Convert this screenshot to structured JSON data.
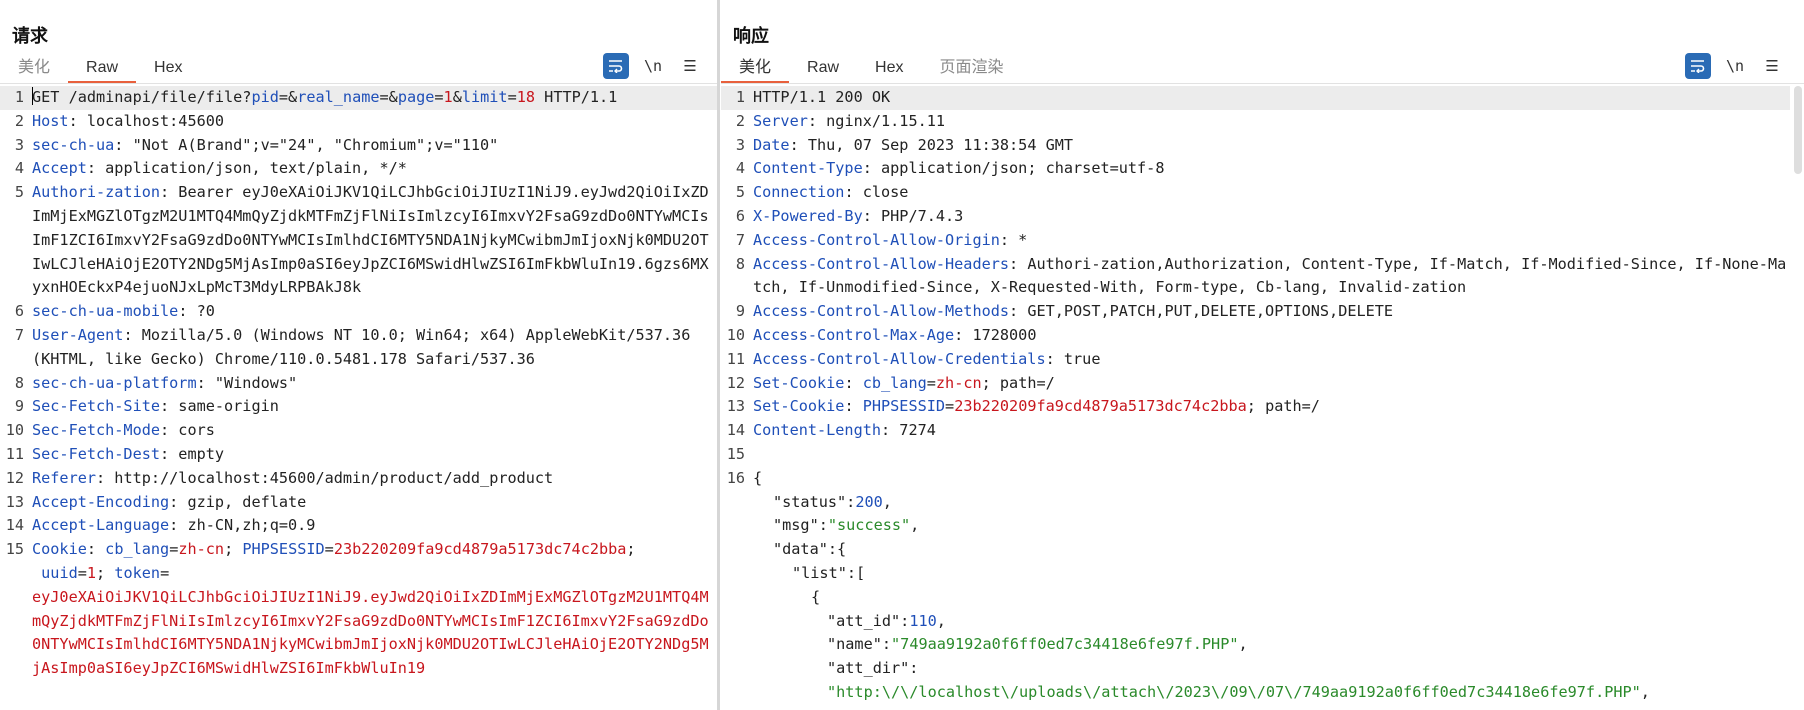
{
  "layout": {
    "btn_split": "split-view",
    "btn_rows": "stacked-view",
    "btn_single": "single-view"
  },
  "request": {
    "title": "请求",
    "tabs": [
      "美化",
      "Raw",
      "Hex"
    ],
    "active_tab": "Raw",
    "tool_wrap": "≡",
    "tool_newline": "\\n",
    "tool_menu": "☰",
    "lines": {
      "l1": {
        "method": "GET /adminapi/file/file?",
        "p1": "pid",
        "eq": "=",
        "amp": "&",
        "p2": "real_name",
        "p3": "page",
        "v3": "1",
        "p4": "limit",
        "v4": "18",
        "proto": " HTTP/1.1"
      },
      "l2": {
        "key": "Host",
        "val": ": localhost:45600"
      },
      "l3": {
        "key": "sec-ch-ua",
        "val": ": \"Not A(Brand\";v=\"24\", \"Chromium\";v=\"110\""
      },
      "l4": {
        "key": "Accept",
        "val": ": application/json, text/plain, */*"
      },
      "l5": {
        "key": "Authori-zation",
        "val": ": Bearer eyJ0eXAiOiJKV1QiLCJhbGciOiJIUzI1NiJ9.eyJwd2QiOiIxZDImMjExMGZlOTgzM2U1MTQ4MmQyZjdkMTFmZjFlNiIsImlzcyI6ImxvY2FsaG9zdDo0NTYwMCIsImF1ZCI6ImxvY2FsaG9zdDo0NTYwMCIsImlhdCI6MTY5NDA1NjkyMCwibmJmIjoxNjk0MDU2OTIwLCJleHAiOjE2OTY2NDg5MjAsImp0aSI6eyJpZCI6MSwidHlwZSI6ImFkbWluIn19.6gzs6MXyxnHOEckxP4ejuoNJxLpMcT3MdyLRPBAkJ8k"
      },
      "l6": {
        "key": "sec-ch-ua-mobile",
        "val": ": ?0"
      },
      "l7": {
        "key": "User-Agent",
        "val": ": Mozilla/5.0 (Windows NT 10.0; Win64; x64) AppleWebKit/537.36 (KHTML, like Gecko) Chrome/110.0.5481.178 Safari/537.36"
      },
      "l8": {
        "key": "sec-ch-ua-platform",
        "val": ": \"Windows\""
      },
      "l9": {
        "key": "Sec-Fetch-Site",
        "val": ": same-origin"
      },
      "l10": {
        "key": "Sec-Fetch-Mode",
        "val": ": cors"
      },
      "l11": {
        "key": "Sec-Fetch-Dest",
        "val": ": empty"
      },
      "l12": {
        "key": "Referer",
        "val": ": http://localhost:45600/admin/product/add_product"
      },
      "l13": {
        "key": "Accept-Encoding",
        "val": ": gzip, deflate"
      },
      "l14": {
        "key": "Accept-Language",
        "val": ": zh-CN,zh;q=0.9"
      },
      "l15": {
        "key": "Cookie",
        "sep": ": ",
        "c1k": "cb_lang",
        "eq": "=",
        "c1v": "zh-cn",
        "semi": "; ",
        "c2k": "PHPSESSID",
        "c2v": "23b220209fa9cd4879a5173dc74c2bba",
        "semi2": ";",
        "c3k": " uuid",
        "c3v": "1",
        "semi3": "; ",
        "c4k": "token",
        "eq2": "=",
        "c4v": "eyJ0eXAiOiJKV1QiLCJhbGciOiJIUzI1NiJ9.eyJwd2QiOiIxZDImMjExMGZlOTgzM2U1MTQ4MmQyZjdkMTFmZjFlNiIsImlzcyI6ImxvY2FsaG9zdDo0NTYwMCIsImF1ZCI6ImxvY2FsaG9zdDo0NTYwMCIsImlhdCI6MTY5NDA1NjkyMCwibmJmIjoxNjk0MDU2OTIwLCJleHAiOjE2OTY2NDg5MjAsImp0aSI6eyJpZCI6MSwidHlwZSI6ImFkbWluIn19"
      }
    }
  },
  "response": {
    "title": "响应",
    "tabs": [
      "美化",
      "Raw",
      "Hex",
      "页面渲染"
    ],
    "active_tab": "美化",
    "tool_wrap": "≡",
    "tool_newline": "\\n",
    "tool_menu": "☰",
    "lines": {
      "l1": "HTTP/1.1 200 OK",
      "l2": {
        "key": "Server",
        "val": ": nginx/1.15.11"
      },
      "l3": {
        "key": "Date",
        "val": ": Thu, 07 Sep 2023 11:38:54 GMT"
      },
      "l4": {
        "key": "Content-Type",
        "val": ": application/json; charset=utf-8"
      },
      "l5": {
        "key": "Connection",
        "val": ": close"
      },
      "l6": {
        "key": "X-Powered-By",
        "val": ": PHP/7.4.3"
      },
      "l7": {
        "key": "Access-Control-Allow-Origin",
        "val": ": *"
      },
      "l8": {
        "key": "Access-Control-Allow-Headers",
        "val": ": Authori-zation,Authorization, Content-Type, If-Match, If-Modified-Since, If-None-Match, If-Unmodified-Since, X-Requested-With, Form-type, Cb-lang, Invalid-zation"
      },
      "l9": {
        "key": "Access-Control-Allow-Methods",
        "val": ": GET,POST,PATCH,PUT,DELETE,OPTIONS,DELETE"
      },
      "l10": {
        "key": "Access-Control-Max-Age",
        "val": ": 1728000"
      },
      "l11": {
        "key": "Access-Control-Allow-Credentials",
        "val": ": true"
      },
      "l12": {
        "key": "Set-Cookie",
        "sep": ": ",
        "ck": "cb_lang",
        "eq": "=",
        "cv": "zh-cn",
        "rest": "; path=/"
      },
      "l13": {
        "key": "Set-Cookie",
        "sep": ": ",
        "ck": "PHPSESSID",
        "eq": "=",
        "cv": "23b220209fa9cd4879a5173dc74c2bba",
        "rest": "; path=/"
      },
      "l14": {
        "key": "Content-Length",
        "val": ": 7274"
      },
      "l16": "{",
      "j_status_k": "\"status\"",
      "j_status_v": "200",
      "j_msg_k": "\"msg\"",
      "j_msg_v": "\"success\"",
      "j_data_k": "\"data\"",
      "j_data_open": ":{",
      "j_list_k": "\"list\"",
      "j_list_open": ":[",
      "j_obj_open": "{",
      "j_attid_k": "\"att_id\"",
      "j_attid_v": "110",
      "j_name_k": "\"name\"",
      "j_name_v": "\"749aa9192a0f6ff0ed7c34418e6fe97f.PHP\"",
      "j_attdir_k": "\"att_dir\"",
      "j_attdir_v": "\"http:\\/\\/localhost\\/uploads\\/attach\\/2023\\/09\\/07\\/749aa9192a0f6ff0ed7c34418e6fe97f.PHP\"",
      "colon": ":",
      "comma": ","
    }
  }
}
